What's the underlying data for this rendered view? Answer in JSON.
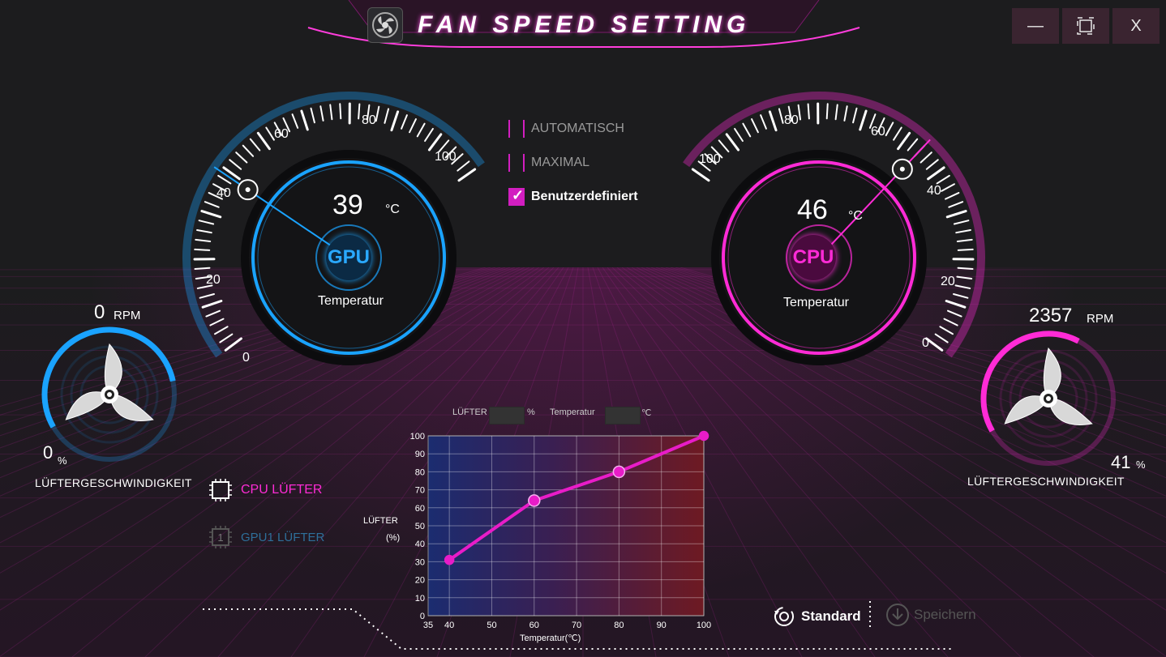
{
  "window": {
    "title": "FAN SPEED SETTING",
    "minimize": "—",
    "maximize": "⧉",
    "close": "X"
  },
  "gpu_gauge": {
    "ticks": [
      "0",
      "20",
      "40",
      "60",
      "80",
      "100"
    ],
    "temperature": "39",
    "unit": "°C",
    "chip_label": "GPU",
    "caption": "Temperatur",
    "color": "#1aa3ff",
    "temperature_value": 39
  },
  "cpu_gauge": {
    "ticks": [
      "0",
      "20",
      "40",
      "60",
      "80",
      "100"
    ],
    "temperature": "46",
    "unit": "°C",
    "chip_label": "CPU",
    "caption": "Temperatur",
    "color": "#ff2bd6",
    "temperature_value": 46
  },
  "modes": [
    {
      "label": "AUTOMATISCH",
      "checked": false
    },
    {
      "label": "MAXIMAL",
      "checked": false
    },
    {
      "label": "Benutzerdefiniert",
      "checked": true
    }
  ],
  "gpu_fan": {
    "rpm": "0",
    "rpm_unit": "RPM",
    "percent": "0",
    "percent_unit": "%",
    "caption": "LÜFTERGESCHWINDIGKEIT",
    "ring_fraction": 0.55
  },
  "cpu_fan": {
    "rpm": "2357",
    "rpm_unit": "RPM",
    "percent": "41",
    "percent_unit": "%",
    "caption": "LÜFTERGESCHWINDIGKEIT",
    "ring_fraction": 0.41
  },
  "fan_selector": {
    "cpu": "CPU LÜFTER",
    "gpu": "GPU1 LÜFTER",
    "gpu_icon_text": "1"
  },
  "curve_fields": {
    "fan_label": "LÜFTER",
    "fan_unit": "%",
    "temp_label": "Temperatur",
    "temp_unit": "℃"
  },
  "chart_data": {
    "type": "line",
    "xlabel": "Temperatur(℃)",
    "ylabel": "LÜFTER",
    "ylabel_unit": "(%)",
    "x_ticks": [
      35,
      40,
      50,
      60,
      70,
      80,
      90,
      100
    ],
    "y_ticks": [
      0,
      10,
      20,
      30,
      40,
      50,
      60,
      70,
      80,
      90,
      100
    ],
    "xlim": [
      35,
      100
    ],
    "ylim": [
      0,
      100
    ],
    "grid": true,
    "series": [
      {
        "x": [
          40,
          60,
          80,
          100
        ],
        "y": [
          31,
          64,
          80,
          100
        ]
      }
    ],
    "line_color": "#e81cc8"
  },
  "buttons": {
    "standard": "Standard",
    "save": "Speichern"
  }
}
